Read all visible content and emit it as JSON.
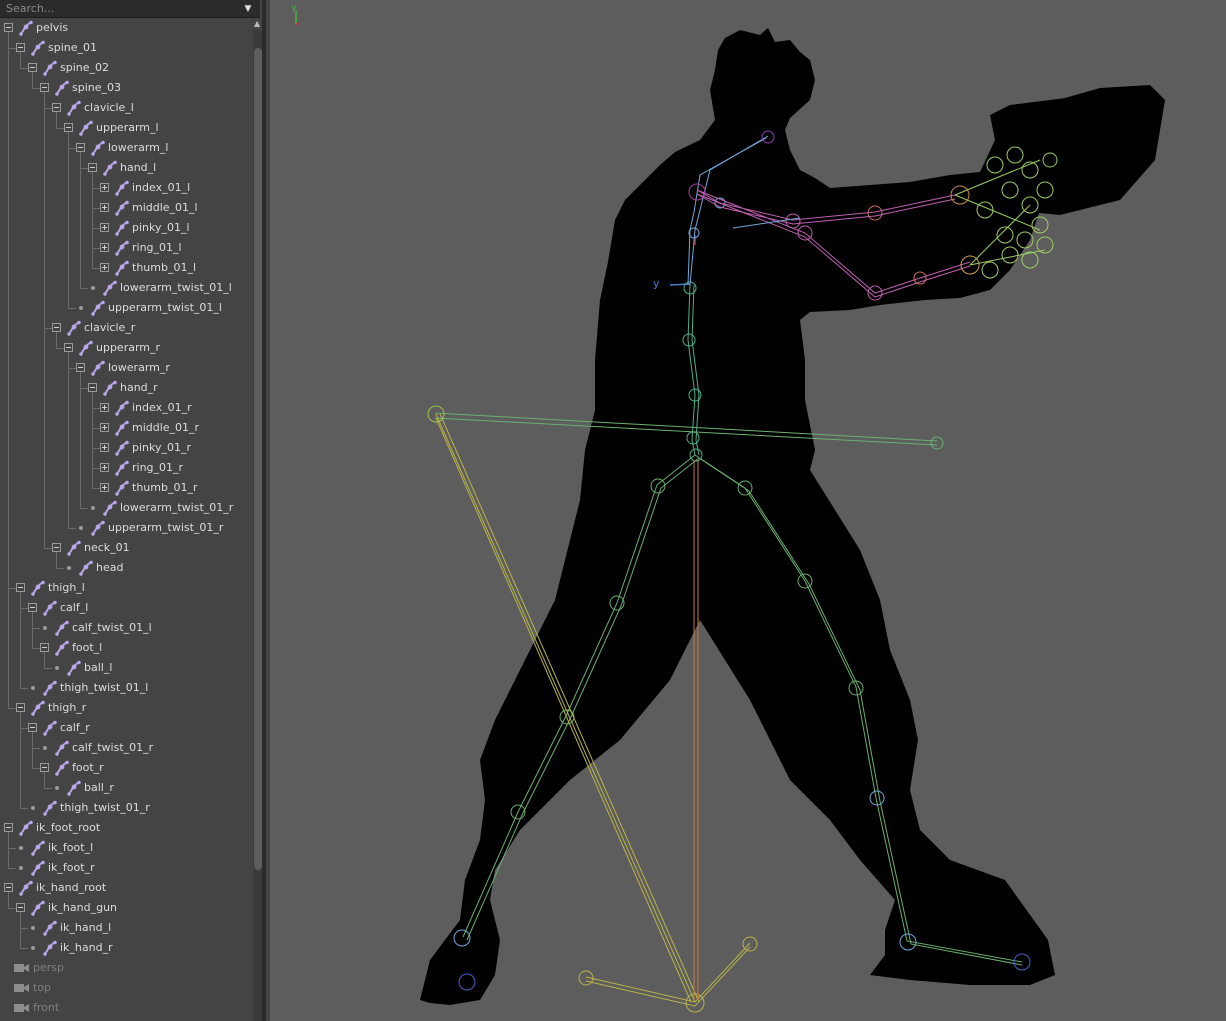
{
  "search": {
    "placeholder": "Search...",
    "dropdown_icon": "chevron-down-icon"
  },
  "outliner": {
    "items": [
      {
        "label": "pelvis",
        "depth": 0,
        "expander": "minus",
        "type": "joint"
      },
      {
        "label": "spine_01",
        "depth": 1,
        "expander": "minus",
        "type": "joint"
      },
      {
        "label": "spine_02",
        "depth": 2,
        "expander": "minus",
        "type": "joint"
      },
      {
        "label": "spine_03",
        "depth": 3,
        "expander": "minus",
        "type": "joint"
      },
      {
        "label": "clavicle_l",
        "depth": 4,
        "expander": "minus",
        "type": "joint"
      },
      {
        "label": "upperarm_l",
        "depth": 5,
        "expander": "minus",
        "type": "joint"
      },
      {
        "label": "lowerarm_l",
        "depth": 6,
        "expander": "minus",
        "type": "joint"
      },
      {
        "label": "hand_l",
        "depth": 7,
        "expander": "minus",
        "type": "joint"
      },
      {
        "label": "index_01_l",
        "depth": 8,
        "expander": "plus",
        "type": "joint"
      },
      {
        "label": "middle_01_l",
        "depth": 8,
        "expander": "plus",
        "type": "joint"
      },
      {
        "label": "pinky_01_l",
        "depth": 8,
        "expander": "plus",
        "type": "joint"
      },
      {
        "label": "ring_01_l",
        "depth": 8,
        "expander": "plus",
        "type": "joint"
      },
      {
        "label": "thumb_01_l",
        "depth": 8,
        "expander": "plus",
        "type": "joint"
      },
      {
        "label": "lowerarm_twist_01_l",
        "depth": 7,
        "expander": "dot",
        "type": "joint"
      },
      {
        "label": "upperarm_twist_01_l",
        "depth": 6,
        "expander": "dot",
        "type": "joint"
      },
      {
        "label": "clavicle_r",
        "depth": 4,
        "expander": "minus",
        "type": "joint"
      },
      {
        "label": "upperarm_r",
        "depth": 5,
        "expander": "minus",
        "type": "joint"
      },
      {
        "label": "lowerarm_r",
        "depth": 6,
        "expander": "minus",
        "type": "joint"
      },
      {
        "label": "hand_r",
        "depth": 7,
        "expander": "minus",
        "type": "joint"
      },
      {
        "label": "index_01_r",
        "depth": 8,
        "expander": "plus",
        "type": "joint"
      },
      {
        "label": "middle_01_r",
        "depth": 8,
        "expander": "plus",
        "type": "joint"
      },
      {
        "label": "pinky_01_r",
        "depth": 8,
        "expander": "plus",
        "type": "joint"
      },
      {
        "label": "ring_01_r",
        "depth": 8,
        "expander": "plus",
        "type": "joint"
      },
      {
        "label": "thumb_01_r",
        "depth": 8,
        "expander": "plus",
        "type": "joint"
      },
      {
        "label": "lowerarm_twist_01_r",
        "depth": 7,
        "expander": "dot",
        "type": "joint"
      },
      {
        "label": "upperarm_twist_01_r",
        "depth": 6,
        "expander": "dot",
        "type": "joint"
      },
      {
        "label": "neck_01",
        "depth": 4,
        "expander": "minus",
        "type": "joint"
      },
      {
        "label": "head",
        "depth": 5,
        "expander": "dot",
        "type": "joint"
      },
      {
        "label": "thigh_l",
        "depth": 1,
        "expander": "minus",
        "type": "joint"
      },
      {
        "label": "calf_l",
        "depth": 2,
        "expander": "minus",
        "type": "joint"
      },
      {
        "label": "calf_twist_01_l",
        "depth": 3,
        "expander": "dot",
        "type": "joint"
      },
      {
        "label": "foot_l",
        "depth": 3,
        "expander": "minus",
        "type": "joint"
      },
      {
        "label": "ball_l",
        "depth": 4,
        "expander": "dot",
        "type": "joint"
      },
      {
        "label": "thigh_twist_01_l",
        "depth": 2,
        "expander": "dot",
        "type": "joint"
      },
      {
        "label": "thigh_r",
        "depth": 1,
        "expander": "minus",
        "type": "joint"
      },
      {
        "label": "calf_r",
        "depth": 2,
        "expander": "minus",
        "type": "joint"
      },
      {
        "label": "calf_twist_01_r",
        "depth": 3,
        "expander": "dot",
        "type": "joint"
      },
      {
        "label": "foot_r",
        "depth": 3,
        "expander": "minus",
        "type": "joint"
      },
      {
        "label": "ball_r",
        "depth": 4,
        "expander": "dot",
        "type": "joint"
      },
      {
        "label": "thigh_twist_01_r",
        "depth": 2,
        "expander": "dot",
        "type": "joint"
      },
      {
        "label": "ik_foot_root",
        "depth": 0,
        "expander": "minus",
        "type": "joint"
      },
      {
        "label": "ik_foot_l",
        "depth": 1,
        "expander": "dot",
        "type": "joint"
      },
      {
        "label": "ik_foot_r",
        "depth": 1,
        "expander": "dot",
        "type": "joint"
      },
      {
        "label": "ik_hand_root",
        "depth": 0,
        "expander": "minus",
        "type": "joint"
      },
      {
        "label": "ik_hand_gun",
        "depth": 1,
        "expander": "minus",
        "type": "joint"
      },
      {
        "label": "ik_hand_l",
        "depth": 2,
        "expander": "dot",
        "type": "joint"
      },
      {
        "label": "ik_hand_r",
        "depth": 2,
        "expander": "dot",
        "type": "joint"
      },
      {
        "label": "persp",
        "depth": 0,
        "expander": "none",
        "type": "camera"
      },
      {
        "label": "top",
        "depth": 0,
        "expander": "none",
        "type": "camera"
      },
      {
        "label": "front",
        "depth": 0,
        "expander": "none",
        "type": "camera"
      }
    ]
  },
  "viewport": {
    "axis_label_y": "y",
    "axis_label_x": "x",
    "local_axis_label": "y",
    "colors": {
      "background": "#5d5d5d",
      "silhouette": "#000000",
      "joint_arm": "#c060b0",
      "joint_spine": "#4cb08c",
      "joint_leg": "#6ab070",
      "joint_hand": "#9ccc66",
      "ik_line": "#b9b44a",
      "root_line": "#c87a3a"
    }
  }
}
